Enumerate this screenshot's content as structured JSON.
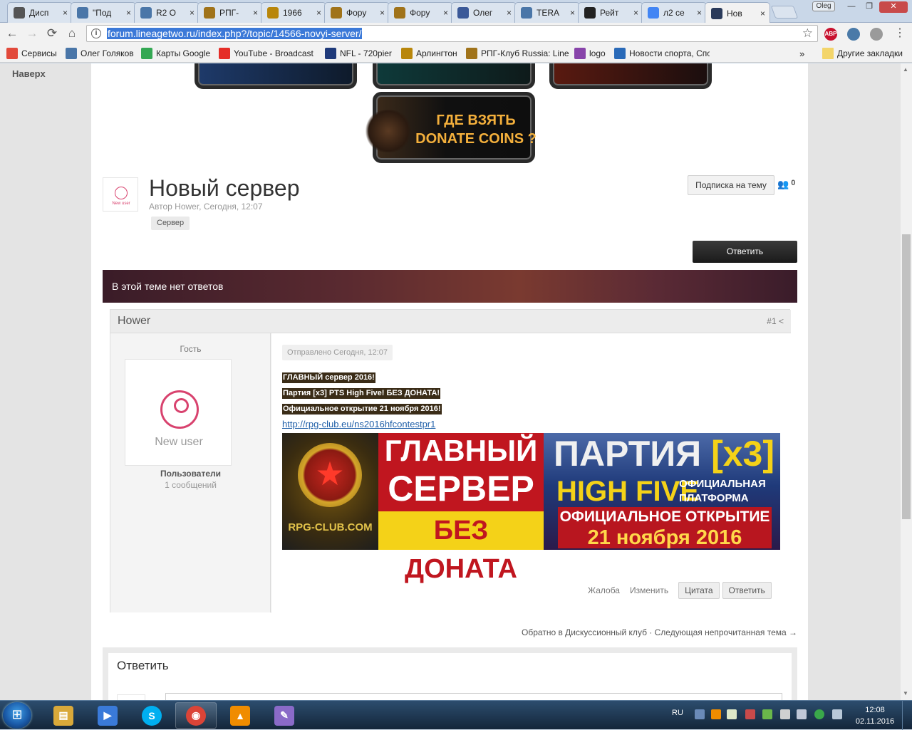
{
  "browser": {
    "tabs": [
      {
        "title": "Дисп",
        "icon": "star-icon",
        "color": "#555555",
        "active": false
      },
      {
        "title": "\"Под",
        "icon": "vk-icon",
        "color": "#4a76a8",
        "active": false
      },
      {
        "title": "R2 O",
        "icon": "vk-icon",
        "color": "#4a76a8",
        "active": false
      },
      {
        "title": "РПГ-",
        "icon": "rpg-club-icon",
        "color": "#a0731a",
        "active": false
      },
      {
        "title": "1966",
        "icon": "coin-icon",
        "color": "#b8860b",
        "active": false
      },
      {
        "title": "Фору",
        "icon": "rpg-club-icon",
        "color": "#a0731a",
        "active": false
      },
      {
        "title": "Фору",
        "icon": "rpg-club-icon",
        "color": "#a0731a",
        "active": false
      },
      {
        "title": "Олег",
        "icon": "facebook-icon",
        "color": "#3b5998",
        "active": false
      },
      {
        "title": "TERA",
        "icon": "vk-icon",
        "color": "#4a76a8",
        "active": false
      },
      {
        "title": "Рейт",
        "icon": "l2top-icon",
        "color": "#222222",
        "active": false
      },
      {
        "title": "л2 се",
        "icon": "google-icon",
        "color": "#4285f4",
        "active": false
      },
      {
        "title": "Нов",
        "icon": "lineage-icon",
        "color": "#2a3a5a",
        "active": true
      }
    ],
    "tab_close": "×",
    "user_badge": "Oleg",
    "window_controls": {
      "minimize": "—",
      "maximize": "❐",
      "close": "✕"
    },
    "nav": {
      "back": "←",
      "forward": "→",
      "reload": "⟳",
      "home": "⌂"
    },
    "url": "forum.lineagetwo.ru/index.php?/topic/14566-novyi-server/",
    "info": "i",
    "star": "☆",
    "extensions": [
      {
        "name": "abp-icon",
        "label": "ABP",
        "color": "#c8102e"
      },
      {
        "name": "extension-icon",
        "label": "",
        "color": "#4a7aa8"
      },
      {
        "name": "gear-extension-icon",
        "label": "",
        "color": "#9a9a9a"
      }
    ],
    "menu": "⋮",
    "bookmarks": [
      {
        "label": "Сервисы",
        "icon": "apps-icon",
        "color": "#e24a3b"
      },
      {
        "label": "Олег Голяков",
        "icon": "vk-icon",
        "color": "#4a76a8"
      },
      {
        "label": "Карты Google",
        "icon": "maps-icon",
        "color": "#34a853"
      },
      {
        "label": "YouTube - Broadcast",
        "icon": "youtube-icon",
        "color": "#e52d27"
      },
      {
        "label": "NFL - 720pier",
        "icon": "nfl-icon",
        "color": "#1f3a7a"
      },
      {
        "label": "Арлингтон",
        "icon": "coin-icon",
        "color": "#b8860b"
      },
      {
        "label": "РПГ-Клуб Russia: Line",
        "icon": "rpg-club-icon",
        "color": "#a0731a"
      },
      {
        "label": "logo",
        "icon": "logo-icon",
        "color": "#8844aa"
      },
      {
        "label": "Новости спорта, Спо",
        "icon": "sb-icon",
        "color": "#2a6ab8"
      }
    ],
    "bookmarks_more": "»",
    "other_bookmarks": "Другие закладки"
  },
  "page": {
    "top_link": "Наверх",
    "donate_banner": "ГДЕ ВЗЯТЬ DONATE COINS ?",
    "topic": {
      "avatar_label": "New user",
      "title": "Новый сервер",
      "meta": "Автор Hower, Сегодня, 12:07",
      "tag": "Сервер",
      "subscribe": "Подписка на тему",
      "followers": "0",
      "reply_button": "Ответить",
      "no_replies": "В этой теме нет ответов"
    },
    "post": {
      "author": "Hower",
      "number": "#1",
      "group": "Гость",
      "avatar_label": "New user",
      "role": "Пользователи",
      "count": "1 сообщений",
      "date": "Отправлено Сегодня, 12:07",
      "lines": [
        "ГЛАВНЫЙ сервер 2016!",
        "Партия [x3] PTS High Five! БЕЗ ДОНАТА!",
        "Официальное открытие 21 ноября 2016!"
      ],
      "link": "http://rpg-club.eu/ns2016hfcontestpr1",
      "promo": {
        "site": "RPG-CLUB.COM",
        "line1": "ГЛАВНЫЙ",
        "line2": "СЕРВЕР",
        "line3": "БЕЗ ДОНАТА",
        "party": "ПАРТИЯ",
        "rate": "[x3]",
        "chronicle": "HIGH FIVE",
        "platform": "ОФИЦИАЛЬНАЯ ПЛАТФОРМА",
        "opening": "ОФИЦИАЛЬНОЕ ОТКРЫТИЕ",
        "date": "21 ноября 2016"
      },
      "actions": {
        "report": "Жалоба",
        "edit": "Изменить",
        "quote": "Цитата",
        "reply": "Ответить"
      }
    },
    "nav_links": "Обратно в Дискуссионный клуб · Следующая непрочитанная тема →",
    "reply_box_title": "Ответить"
  },
  "taskbar": {
    "start": "⊞",
    "items": [
      {
        "name": "explorer-icon",
        "color": "#d9a93a",
        "label": "▤"
      },
      {
        "name": "media-player-icon",
        "color": "#3a7ad9",
        "label": "▶"
      },
      {
        "name": "skype-icon",
        "color": "#00aff0",
        "label": "S"
      },
      {
        "name": "chrome-icon",
        "color": "#db4437",
        "label": "◉"
      },
      {
        "name": "vlc-icon",
        "color": "#f08c00",
        "label": "▲"
      },
      {
        "name": "paint-icon",
        "color": "#8a6ac8",
        "label": "✎"
      }
    ],
    "language": "RU",
    "time": "12:08",
    "date": "02.11.2016"
  }
}
